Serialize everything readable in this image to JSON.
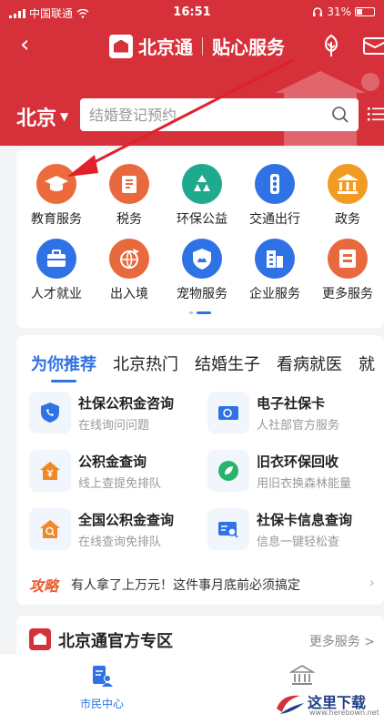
{
  "status_bar": {
    "carrier": "中国联通",
    "time": "16:51",
    "battery": "31%"
  },
  "header": {
    "brand_name": "北京通",
    "brand_tagline": "贴心服务",
    "city": "北京",
    "search_placeholder": "结婚登记预约"
  },
  "services": [
    {
      "label": "教育服务",
      "color": "#ec6a3b",
      "icon": "graduation-cap-icon"
    },
    {
      "label": "税务",
      "color": "#e8693d",
      "icon": "tax-icon"
    },
    {
      "label": "环保公益",
      "color": "#1fa98d",
      "icon": "recycle-icon"
    },
    {
      "label": "交通出行",
      "color": "#2f72e5",
      "icon": "traffic-light-icon"
    },
    {
      "label": "政务",
      "color": "#f19b22",
      "icon": "government-building-icon"
    },
    {
      "label": "人才就业",
      "color": "#2f72e5",
      "icon": "briefcase-icon"
    },
    {
      "label": "出入境",
      "color": "#e8693d",
      "icon": "globe-plane-icon"
    },
    {
      "label": "宠物服务",
      "color": "#2f72e5",
      "icon": "pet-shield-icon"
    },
    {
      "label": "企业服务",
      "color": "#2f72e5",
      "icon": "office-building-icon"
    },
    {
      "label": "更多服务",
      "color": "#e8693d",
      "icon": "more-services-icon"
    }
  ],
  "recommend": {
    "tabs": [
      "为你推荐",
      "北京热门",
      "结婚生子",
      "看病就医",
      "就"
    ],
    "items": [
      {
        "title": "社保公积金咨询",
        "subtitle": "在线询问问题",
        "icon": "shield-phone-icon",
        "color": "#2f72e5"
      },
      {
        "title": "电子社保卡",
        "subtitle": "人社部官方服务",
        "icon": "id-card-icon",
        "color": "#2f72e5"
      },
      {
        "title": "公积金查询",
        "subtitle": "线上查提免排队",
        "icon": "yuan-house-icon",
        "color": "#f0882a"
      },
      {
        "title": "旧衣环保回收",
        "subtitle": "用旧衣换森林能量",
        "icon": "recycle-leaf-icon",
        "color": "#29b36b"
      },
      {
        "title": "全国公积金查询",
        "subtitle": "在线查询免排队",
        "icon": "house-search-icon",
        "color": "#f0882a"
      },
      {
        "title": "社保卡信息查询",
        "subtitle": "信息一键轻松查",
        "icon": "card-search-icon",
        "color": "#2f72e5"
      }
    ],
    "tip_badge": "攻略",
    "tip_text": "有人拿了上万元！这件事月底前必须搞定"
  },
  "zone": {
    "title": "北京通官方专区",
    "more": "更多服务 >"
  },
  "bottom_nav": {
    "citizen_label": "市民中心"
  },
  "watermark": {
    "text": "这里下载",
    "url": "www.herebown.net"
  }
}
